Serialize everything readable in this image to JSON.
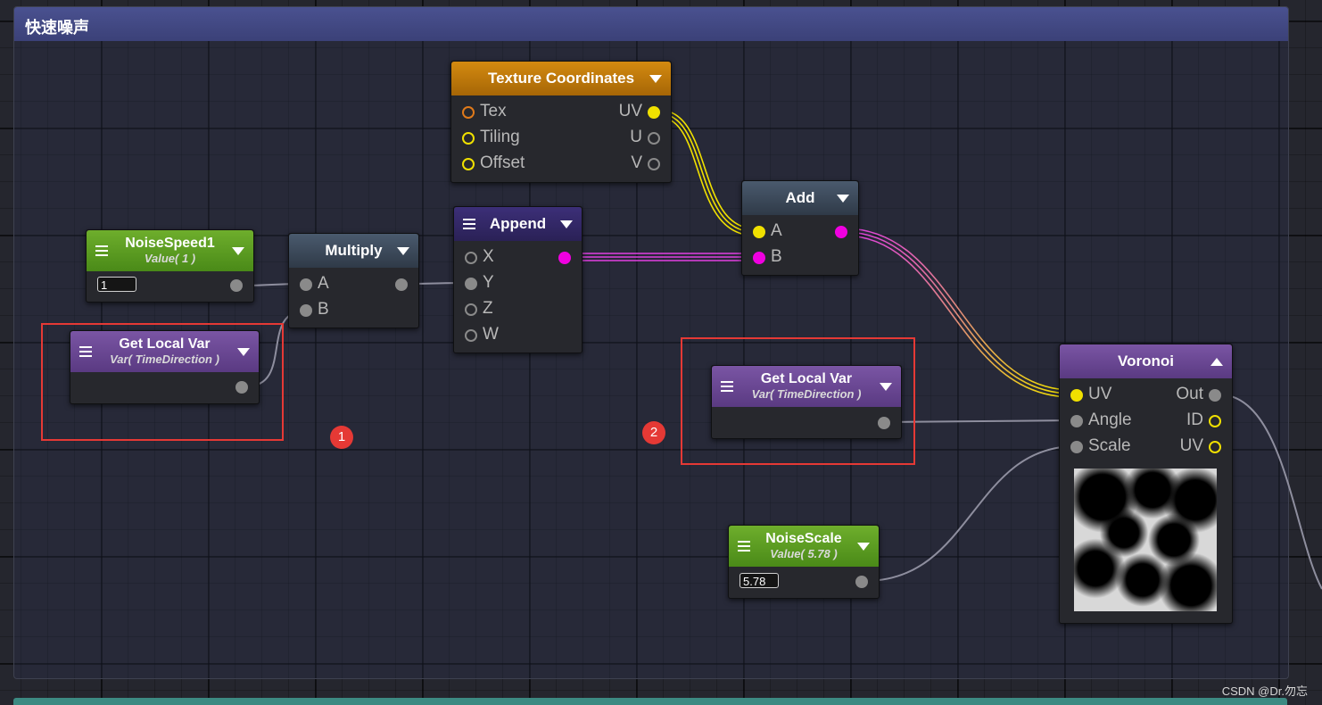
{
  "group": {
    "title": "快速噪声"
  },
  "watermark": "CSDN @Dr.勿忘",
  "colors": {
    "port_yellow": "#f0e000",
    "port_magenta": "#f000e0",
    "port_gray": "#8a8a8a",
    "port_orange": "#e07a1a",
    "annotation_red": "#e53935"
  },
  "nodes": {
    "texture_coordinates": {
      "title": "Texture Coordinates",
      "inputs": [
        "Tex",
        "Tiling",
        "Offset"
      ],
      "outputs": [
        "UV",
        "U",
        "V"
      ]
    },
    "add": {
      "title": "Add",
      "inputs": [
        "A",
        "B"
      ]
    },
    "append": {
      "title": "Append",
      "inputs": [
        "X",
        "Y",
        "Z",
        "W"
      ]
    },
    "multiply": {
      "title": "Multiply",
      "inputs": [
        "A",
        "B"
      ]
    },
    "noise_speed": {
      "title": "NoiseSpeed1",
      "subtitle": "Value( 1 )",
      "value": "1"
    },
    "get_local_var_1": {
      "title": "Get Local Var",
      "subtitle": "Var( TimeDirection )"
    },
    "get_local_var_2": {
      "title": "Get Local Var",
      "subtitle": "Var( TimeDirection )"
    },
    "noise_scale": {
      "title": "NoiseScale",
      "subtitle": "Value( 5.78 )",
      "value": "5.78"
    },
    "voronoi": {
      "title": "Voronoi",
      "inputs": [
        "UV",
        "Angle",
        "Scale"
      ],
      "outputs": [
        "Out",
        "ID",
        "UV"
      ]
    }
  },
  "annotations": {
    "badge_1": "1",
    "badge_2": "2"
  }
}
